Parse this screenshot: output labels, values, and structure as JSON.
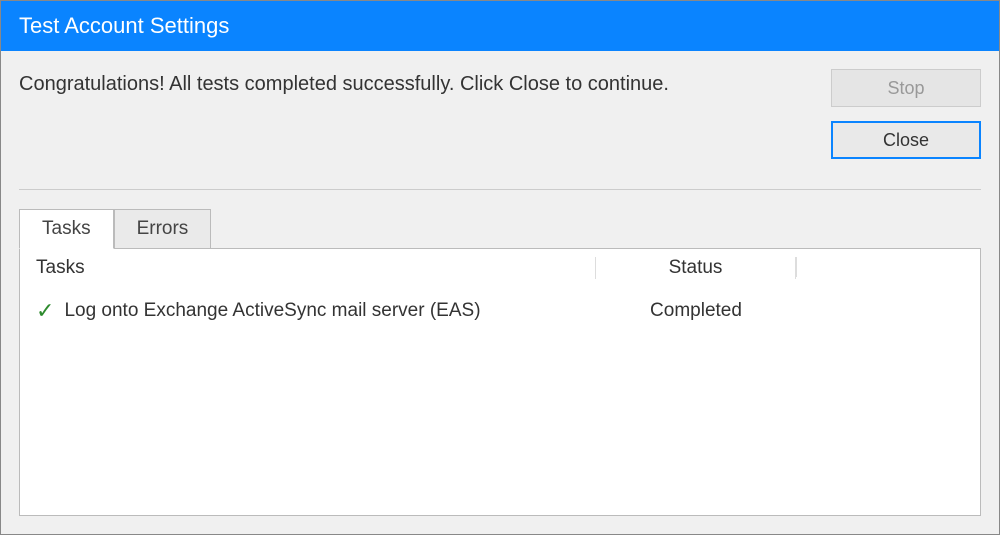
{
  "window": {
    "title": "Test Account Settings"
  },
  "status_message": "Congratulations! All tests completed successfully. Click Close to continue.",
  "buttons": {
    "stop_label": "Stop",
    "close_label": "Close"
  },
  "tabs": {
    "tasks_label": "Tasks",
    "errors_label": "Errors",
    "active": "tasks"
  },
  "table": {
    "columns": {
      "tasks": "Tasks",
      "status": "Status"
    },
    "rows": [
      {
        "icon": "check",
        "task": "Log onto Exchange ActiveSync mail server (EAS)",
        "status": "Completed"
      }
    ]
  }
}
